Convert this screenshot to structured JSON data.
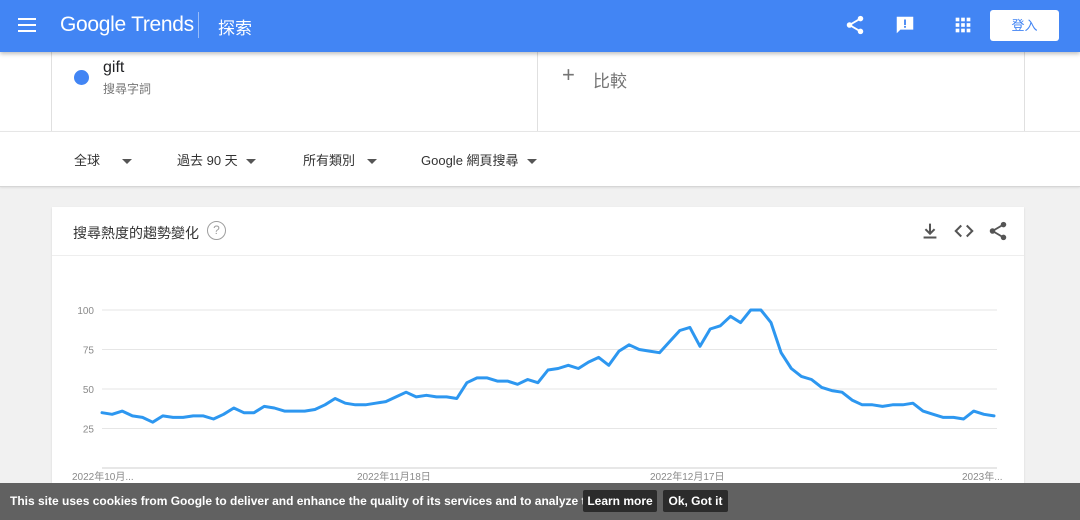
{
  "header": {
    "logo_text": "Google Trends",
    "section_title": "探索",
    "signin_label": "登入"
  },
  "term": {
    "name": "gift",
    "type": "搜尋字詞",
    "color": "#4285f4"
  },
  "compare": {
    "plus": "+",
    "label": "比較"
  },
  "filters": {
    "region": "全球",
    "time": "過去 90 天",
    "category": "所有類別",
    "search_type": "Google 網頁搜尋"
  },
  "card": {
    "title": "搜尋熱度的趨勢變化",
    "help": "?"
  },
  "cookie": {
    "text": "This site uses cookies from Google to deliver and enhance the quality of its services and to analyze traffic.",
    "learn_more": "Learn more",
    "ok": "Ok, Got it"
  },
  "chart_data": {
    "type": "line",
    "ylim": [
      0,
      100
    ],
    "yticks": [
      25,
      50,
      75,
      100
    ],
    "grid": true,
    "line_color": "#2d97f0",
    "x_labels": [
      "2022年10月...",
      "2022年11月18日",
      "2022年12月17日",
      "2023年..."
    ],
    "values": [
      35,
      34,
      36,
      33,
      32,
      29,
      33,
      32,
      32,
      33,
      33,
      31,
      34,
      38,
      35,
      35,
      39,
      38,
      36,
      36,
      36,
      37,
      40,
      44,
      41,
      40,
      40,
      41,
      42,
      45,
      48,
      45,
      46,
      45,
      45,
      44,
      54,
      57,
      57,
      55,
      55,
      53,
      56,
      54,
      62,
      63,
      65,
      63,
      67,
      70,
      65,
      74,
      78,
      75,
      74,
      73,
      80,
      87,
      89,
      77,
      88,
      90,
      96,
      92,
      100,
      100,
      92,
      73,
      63,
      58,
      56,
      51,
      49,
      48,
      43,
      40,
      40,
      39,
      40,
      40,
      41,
      36,
      34,
      32,
      32,
      31,
      36,
      34,
      33
    ]
  }
}
